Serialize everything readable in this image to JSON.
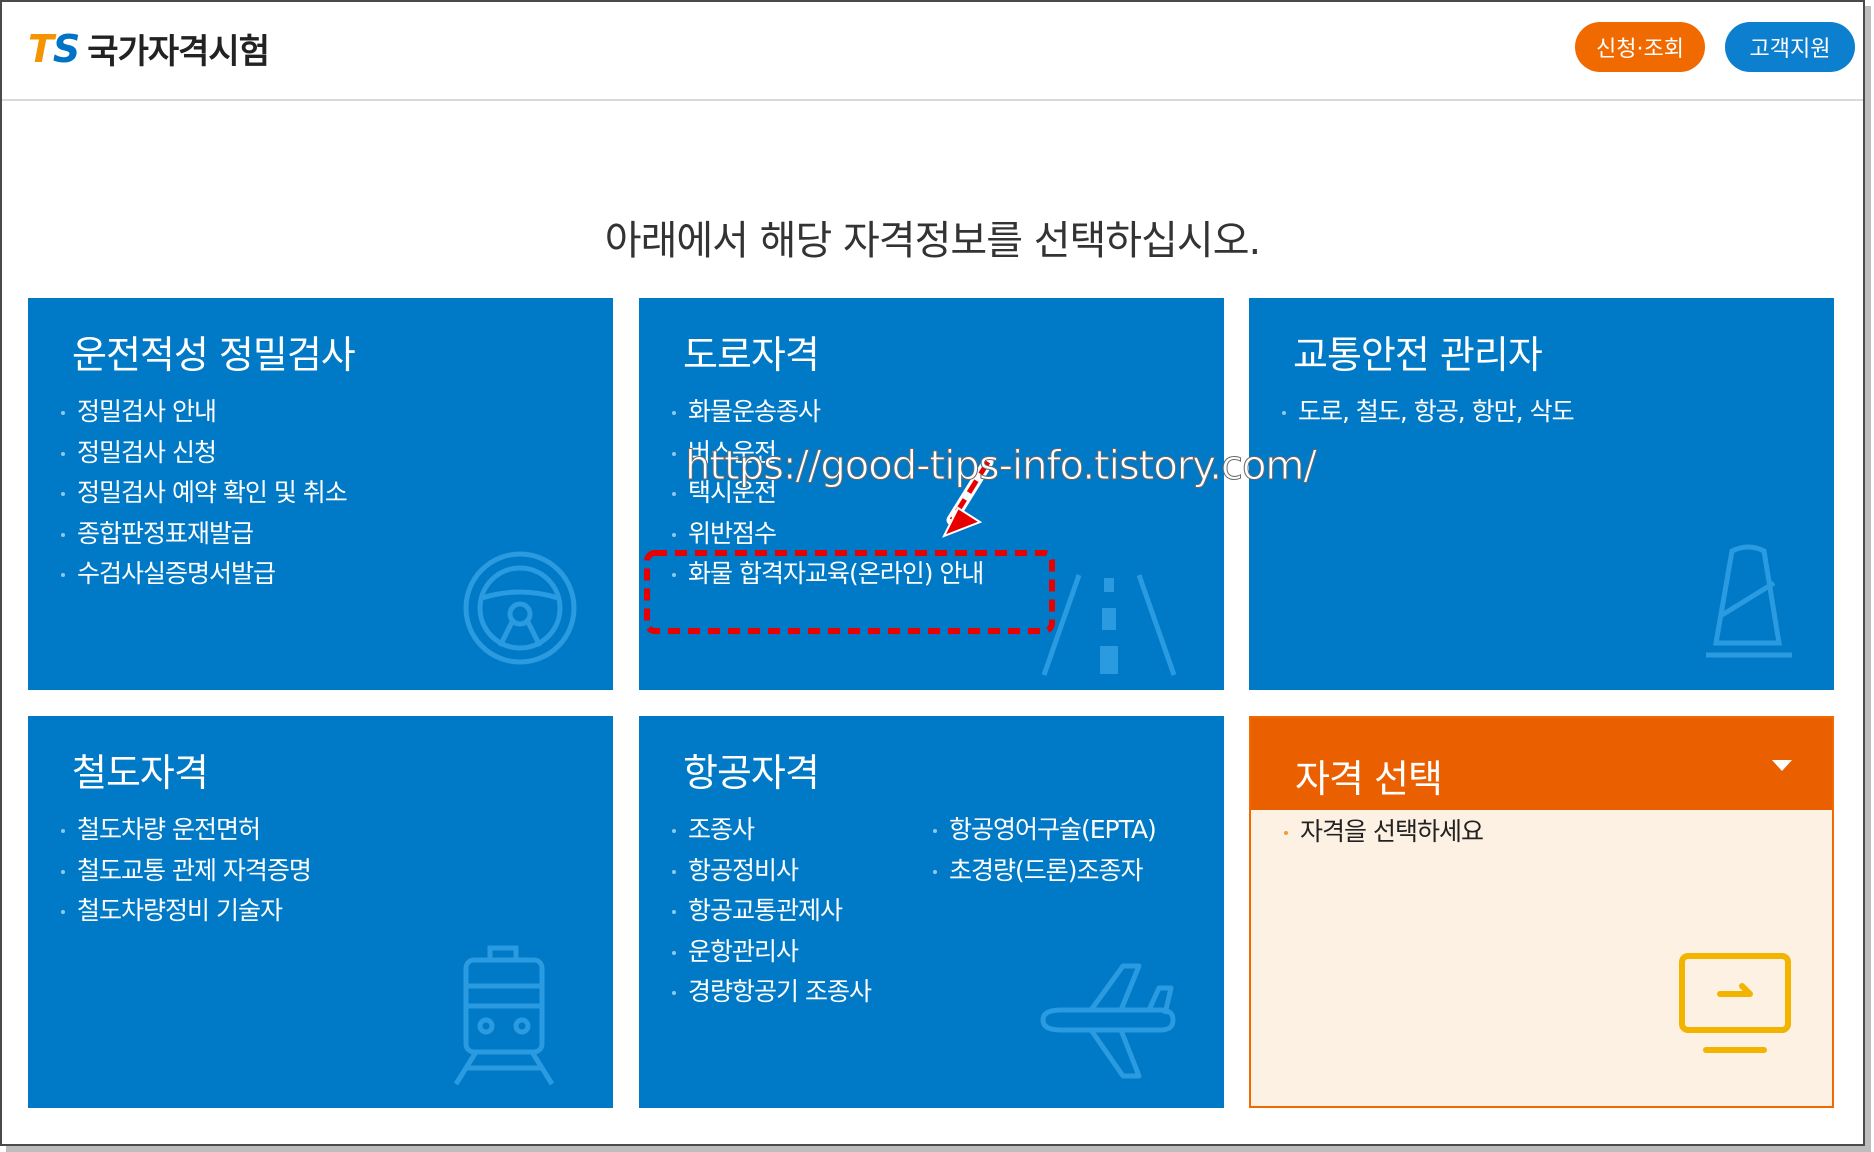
{
  "header": {
    "logo_mark": "TS",
    "logo_text": "국가자격시험",
    "apply_label": "신청·조회",
    "support_label": "고객지원"
  },
  "headline": "아래에서 해당 자격정보를 선택하십시오.",
  "cards": [
    {
      "title": "운전적성 정밀검사",
      "items": [
        "정밀검사 안내",
        "정밀검사 신청",
        "정밀검사 예약 확인 및 취소",
        "종합판정표재발급",
        "수검사실증명서발급"
      ],
      "icon": "steering-wheel-icon"
    },
    {
      "title": "도로자격",
      "items": [
        "화물운송종사",
        "버스운전",
        "택시운전",
        "위반점수",
        "화물 합격자교육(온라인) 안내"
      ],
      "icon": "road-icon"
    },
    {
      "title": "교통안전 관리자",
      "items": [
        "도로, 철도, 항공, 항만, 삭도"
      ],
      "icon": "traffic-cone-icon"
    },
    {
      "title": "철도자격",
      "items": [
        "철도차량 운전면허",
        "철도교통 관제 자격증명",
        "철도차량정비 기술자"
      ],
      "icon": "train-icon"
    },
    {
      "title": "항공자격",
      "items_col1": [
        "조종사",
        "항공정비사",
        "항공교통관제사",
        "운항관리사",
        "경량항공기 조종사"
      ],
      "items_col2": [
        "항공영어구술(EPTA)",
        "초경량(드론)조종자"
      ],
      "icon": "airplane-icon"
    },
    {
      "title": "자격 선택",
      "items": [
        "자격을 선택하세요"
      ],
      "icon": "monitor-icon"
    }
  ],
  "watermark": "https://good-tips-info.tistory.com/",
  "colors": {
    "card_blue": "#0079c6",
    "accent_orange": "#f06a00",
    "support_blue": "#0d7fcf",
    "highlight_red": "#e60000"
  }
}
